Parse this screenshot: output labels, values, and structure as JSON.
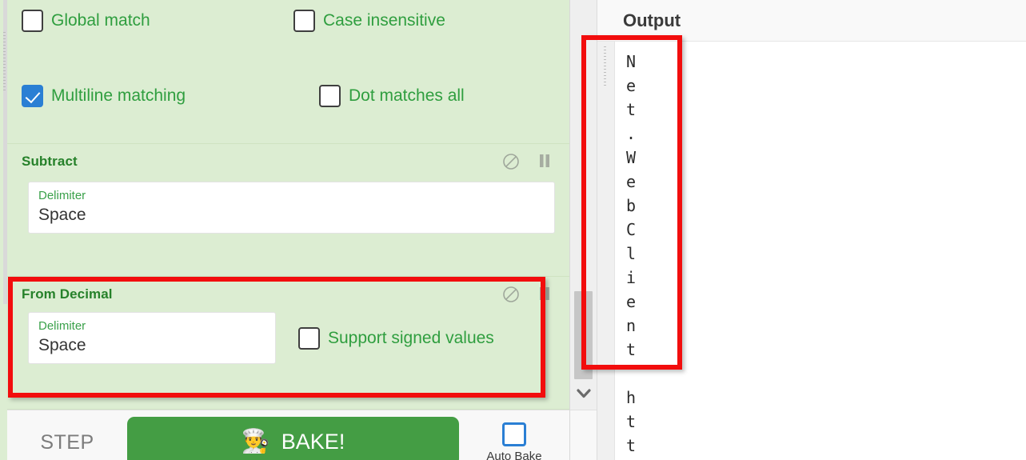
{
  "recipe": {
    "regex_options": {
      "checkboxes": [
        {
          "label": "Global match",
          "checked": false,
          "icon": "checkbox-icon"
        },
        {
          "label": "Case insensitive",
          "checked": false,
          "icon": "checkbox-icon"
        },
        {
          "label": "Multiline matching",
          "checked": true,
          "icon": "checkbox-checked-icon"
        },
        {
          "label": "Dot matches all",
          "checked": false,
          "icon": "checkbox-icon"
        }
      ]
    },
    "operations": [
      {
        "title": "Subtract",
        "disable_icon": "disable-icon",
        "breakpoint_icon": "pause-icon",
        "args": [
          {
            "label": "Delimiter",
            "value": "Space"
          }
        ]
      },
      {
        "title": "From Decimal",
        "disable_icon": "disable-icon",
        "breakpoint_icon": "pause-icon",
        "args": [
          {
            "label": "Delimiter",
            "value": "Space"
          }
        ],
        "checkbox": {
          "label": "Support signed values",
          "checked": false
        }
      }
    ]
  },
  "controls": {
    "step_label": "STEP",
    "bake_label": "BAKE!",
    "bake_icon": "chef-icon",
    "bake_icon_glyph": "👨‍🍳",
    "autobake_label": "Auto Bake",
    "autobake_checked": false
  },
  "splitter": {
    "scroll_down_icon": "chevron-down-icon"
  },
  "output": {
    "title": "Output",
    "text": "N\ne\nt\n.\nW\ne\nb\nC\nl\ni\ne\nn\nt\n\nh\nt\nt"
  },
  "annotations": {
    "highlight_color": "#f20d0d",
    "boxes": [
      {
        "name": "from-decimal-highlight",
        "target": "From Decimal operation"
      },
      {
        "name": "output-highlight",
        "target": "Output text area"
      }
    ]
  },
  "colors": {
    "recipe_background": "#dcedd2",
    "operation_title": "#26812a",
    "checkbox_accent": "#2a7fd4",
    "bake_button": "#449d44",
    "highlight": "#f20d0d"
  }
}
